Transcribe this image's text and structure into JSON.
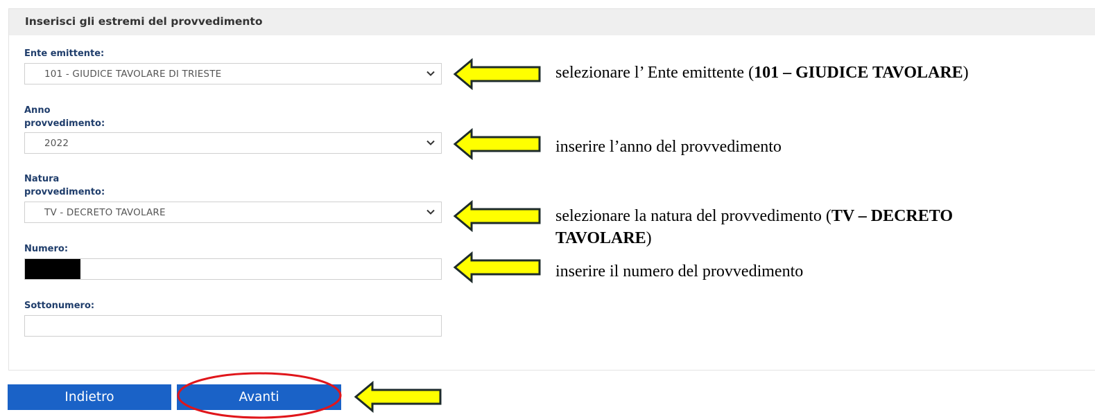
{
  "panel": {
    "title": "Inserisci gli estremi del provvedimento"
  },
  "fields": {
    "ente": {
      "label": "Ente emittente:",
      "value": "101 - GIUDICE TAVOLARE DI TRIESTE"
    },
    "anno": {
      "label_line1": "Anno",
      "label_line2": "provvedimento:",
      "value": "2022"
    },
    "natura": {
      "label_line1": "Natura",
      "label_line2": "provvedimento:",
      "value": "TV - DECRETO TAVOLARE"
    },
    "numero": {
      "label": "Numero:",
      "value": ""
    },
    "sottonumero": {
      "label": "Sottonumero:",
      "value": ""
    }
  },
  "annotations": {
    "ente": {
      "pre": "selezionare l’ Ente emittente (",
      "bold": "101 – GIUDICE TAVOLARE",
      "post": ")"
    },
    "anno": {
      "text": "inserire l’anno del provvedimento"
    },
    "natura": {
      "pre": "selezionare la natura del provvedimento (",
      "bold1": "TV – DECRETO",
      "bold2": "TAVOLARE",
      "post": ")"
    },
    "numero": {
      "text": "inserire il numero del provvedimento"
    }
  },
  "buttons": {
    "back": "Indietro",
    "next": "Avanti"
  },
  "colors": {
    "button_blue": "#1a62c7",
    "label_blue": "#1f3d6b",
    "arrow_yellow": "#ffff00",
    "highlight_red": "#e0161b"
  },
  "icons": {
    "select_chevron": "chevron-down-icon",
    "callout_arrow": "arrow-left-icon"
  }
}
